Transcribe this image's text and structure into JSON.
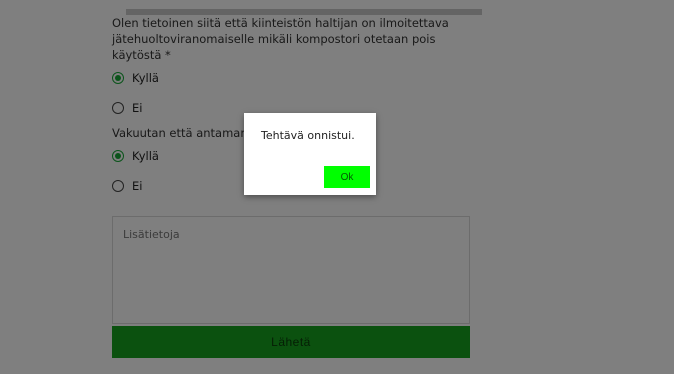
{
  "form": {
    "question1": "Olen tietoinen siitä että kiinteistön haltijan on ilmoitettava jätehuoltoviranomaiselle mikäli kompostori otetaan pois käytöstä *",
    "q1_options": [
      {
        "label": "Kyllä",
        "checked": true
      },
      {
        "label": "Ei",
        "checked": false
      }
    ],
    "question2": "Vakuutan että antamani tiedot ovat oikein *",
    "q2_options": [
      {
        "label": "Kyllä",
        "checked": true
      },
      {
        "label": "Ei",
        "checked": false
      }
    ],
    "notes_placeholder": "Lisätietoja",
    "submit_label": "Lähetä"
  },
  "dialog": {
    "message": "Tehtävä onnistui.",
    "ok_label": "Ok"
  },
  "colors": {
    "accent": "#16a21e",
    "ok_button": "#00ff00",
    "overlay": "rgba(0,0,0,0.5)"
  }
}
